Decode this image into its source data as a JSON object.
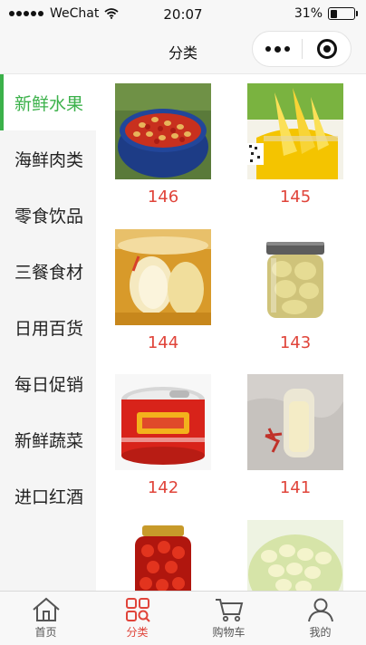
{
  "status_bar": {
    "carrier": "WeChat",
    "time": "20:07",
    "battery_percent_text": "31%",
    "battery_level": 0.31
  },
  "nav": {
    "title": "分类"
  },
  "sidebar": {
    "items": [
      {
        "label": "新鲜水果",
        "active": true
      },
      {
        "label": "海鲜肉类"
      },
      {
        "label": "零食饮品"
      },
      {
        "label": "三餐食材"
      },
      {
        "label": "日用百货"
      },
      {
        "label": "每日促销"
      },
      {
        "label": "新鲜蔬菜"
      },
      {
        "label": "进口红酒"
      }
    ]
  },
  "products": [
    {
      "label": "146",
      "image": "bowl-of-red-beans-icon"
    },
    {
      "label": "145",
      "image": "jar-of-pineapple-icon"
    },
    {
      "label": "144",
      "image": "jar-of-pear-slices-icon"
    },
    {
      "label": "143",
      "image": "glass-jar-of-fruit-icon"
    },
    {
      "label": "142",
      "image": "tin-can-icon"
    },
    {
      "label": "141",
      "image": "jar-of-white-fruit-icon"
    },
    {
      "label": "",
      "image": "jar-of-hawthorn-icon"
    },
    {
      "label": "",
      "image": "bowl-of-lychee-icon"
    }
  ],
  "tab_bar": {
    "items": [
      {
        "label": "首页",
        "icon": "home-icon"
      },
      {
        "label": "分类",
        "icon": "category-icon",
        "active": true
      },
      {
        "label": "购物车",
        "icon": "cart-icon"
      },
      {
        "label": "我的",
        "icon": "user-icon"
      }
    ]
  },
  "colors": {
    "accent_green": "#3bb14a",
    "price_red": "#e0443a",
    "sidebar_bg": "#f5f5f5"
  }
}
